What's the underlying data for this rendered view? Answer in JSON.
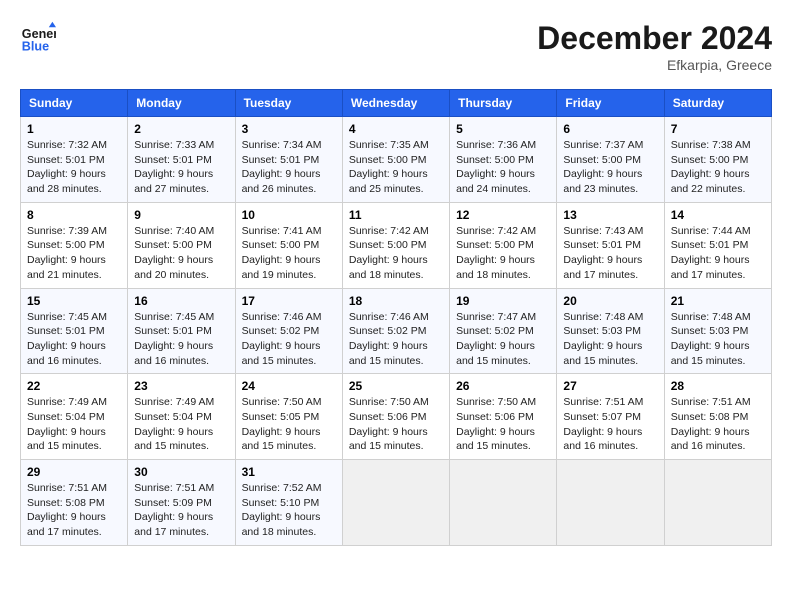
{
  "header": {
    "logo_line1": "General",
    "logo_line2": "Blue",
    "month_title": "December 2024",
    "location": "Efkarpia, Greece"
  },
  "weekdays": [
    "Sunday",
    "Monday",
    "Tuesday",
    "Wednesday",
    "Thursday",
    "Friday",
    "Saturday"
  ],
  "weeks": [
    [
      {
        "day": "1",
        "sunrise": "7:32 AM",
        "sunset": "5:01 PM",
        "daylight": "9 hours and 28 minutes."
      },
      {
        "day": "2",
        "sunrise": "7:33 AM",
        "sunset": "5:01 PM",
        "daylight": "9 hours and 27 minutes."
      },
      {
        "day": "3",
        "sunrise": "7:34 AM",
        "sunset": "5:01 PM",
        "daylight": "9 hours and 26 minutes."
      },
      {
        "day": "4",
        "sunrise": "7:35 AM",
        "sunset": "5:00 PM",
        "daylight": "9 hours and 25 minutes."
      },
      {
        "day": "5",
        "sunrise": "7:36 AM",
        "sunset": "5:00 PM",
        "daylight": "9 hours and 24 minutes."
      },
      {
        "day": "6",
        "sunrise": "7:37 AM",
        "sunset": "5:00 PM",
        "daylight": "9 hours and 23 minutes."
      },
      {
        "day": "7",
        "sunrise": "7:38 AM",
        "sunset": "5:00 PM",
        "daylight": "9 hours and 22 minutes."
      }
    ],
    [
      {
        "day": "8",
        "sunrise": "7:39 AM",
        "sunset": "5:00 PM",
        "daylight": "9 hours and 21 minutes."
      },
      {
        "day": "9",
        "sunrise": "7:40 AM",
        "sunset": "5:00 PM",
        "daylight": "9 hours and 20 minutes."
      },
      {
        "day": "10",
        "sunrise": "7:41 AM",
        "sunset": "5:00 PM",
        "daylight": "9 hours and 19 minutes."
      },
      {
        "day": "11",
        "sunrise": "7:42 AM",
        "sunset": "5:00 PM",
        "daylight": "9 hours and 18 minutes."
      },
      {
        "day": "12",
        "sunrise": "7:42 AM",
        "sunset": "5:00 PM",
        "daylight": "9 hours and 18 minutes."
      },
      {
        "day": "13",
        "sunrise": "7:43 AM",
        "sunset": "5:01 PM",
        "daylight": "9 hours and 17 minutes."
      },
      {
        "day": "14",
        "sunrise": "7:44 AM",
        "sunset": "5:01 PM",
        "daylight": "9 hours and 17 minutes."
      }
    ],
    [
      {
        "day": "15",
        "sunrise": "7:45 AM",
        "sunset": "5:01 PM",
        "daylight": "9 hours and 16 minutes."
      },
      {
        "day": "16",
        "sunrise": "7:45 AM",
        "sunset": "5:01 PM",
        "daylight": "9 hours and 16 minutes."
      },
      {
        "day": "17",
        "sunrise": "7:46 AM",
        "sunset": "5:02 PM",
        "daylight": "9 hours and 15 minutes."
      },
      {
        "day": "18",
        "sunrise": "7:46 AM",
        "sunset": "5:02 PM",
        "daylight": "9 hours and 15 minutes."
      },
      {
        "day": "19",
        "sunrise": "7:47 AM",
        "sunset": "5:02 PM",
        "daylight": "9 hours and 15 minutes."
      },
      {
        "day": "20",
        "sunrise": "7:48 AM",
        "sunset": "5:03 PM",
        "daylight": "9 hours and 15 minutes."
      },
      {
        "day": "21",
        "sunrise": "7:48 AM",
        "sunset": "5:03 PM",
        "daylight": "9 hours and 15 minutes."
      }
    ],
    [
      {
        "day": "22",
        "sunrise": "7:49 AM",
        "sunset": "5:04 PM",
        "daylight": "9 hours and 15 minutes."
      },
      {
        "day": "23",
        "sunrise": "7:49 AM",
        "sunset": "5:04 PM",
        "daylight": "9 hours and 15 minutes."
      },
      {
        "day": "24",
        "sunrise": "7:50 AM",
        "sunset": "5:05 PM",
        "daylight": "9 hours and 15 minutes."
      },
      {
        "day": "25",
        "sunrise": "7:50 AM",
        "sunset": "5:06 PM",
        "daylight": "9 hours and 15 minutes."
      },
      {
        "day": "26",
        "sunrise": "7:50 AM",
        "sunset": "5:06 PM",
        "daylight": "9 hours and 15 minutes."
      },
      {
        "day": "27",
        "sunrise": "7:51 AM",
        "sunset": "5:07 PM",
        "daylight": "9 hours and 16 minutes."
      },
      {
        "day": "28",
        "sunrise": "7:51 AM",
        "sunset": "5:08 PM",
        "daylight": "9 hours and 16 minutes."
      }
    ],
    [
      {
        "day": "29",
        "sunrise": "7:51 AM",
        "sunset": "5:08 PM",
        "daylight": "9 hours and 17 minutes."
      },
      {
        "day": "30",
        "sunrise": "7:51 AM",
        "sunset": "5:09 PM",
        "daylight": "9 hours and 17 minutes."
      },
      {
        "day": "31",
        "sunrise": "7:52 AM",
        "sunset": "5:10 PM",
        "daylight": "9 hours and 18 minutes."
      },
      null,
      null,
      null,
      null
    ]
  ]
}
